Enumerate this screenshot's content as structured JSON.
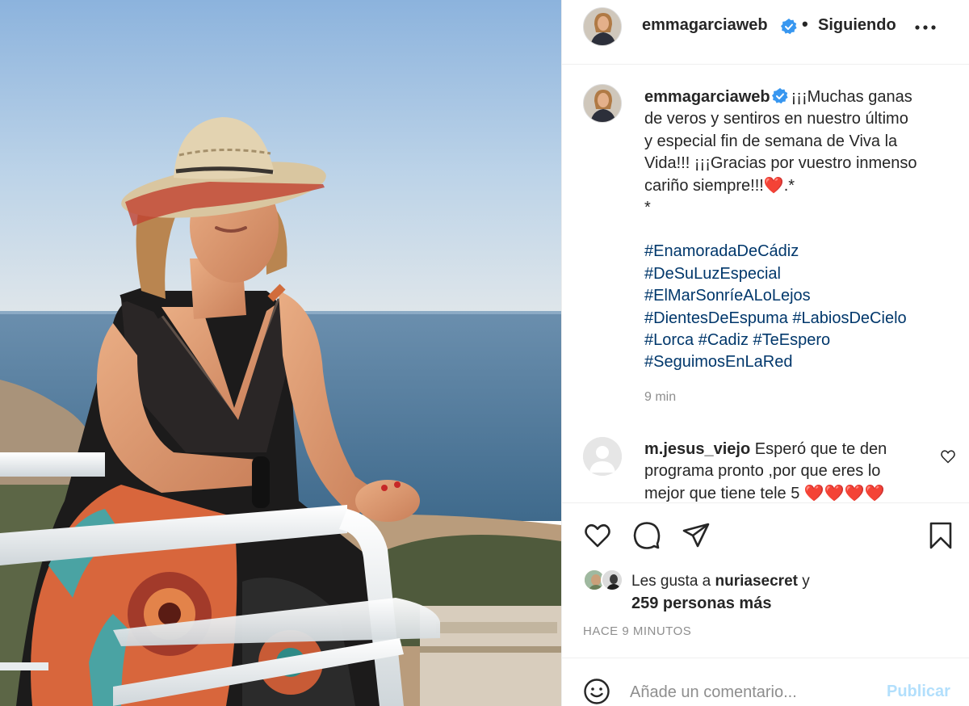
{
  "post": {
    "username": "emmagarciaweb",
    "follow_label": "Siguiendo",
    "separator": "•",
    "caption_lines": [
      "¡¡¡Muchas ganas",
      "de veros y sentiros en nuestro último",
      "y especial fin de semana de Viva la",
      "Vida!!! ¡¡¡Gracias por vuestro inmenso",
      "cariño siempre!!!❤️.*",
      "*"
    ],
    "hashtag_lines": [
      "#EnamoradaDeCádiz",
      "#DeSuLuzEspecial",
      "#ElMarSonríeALoLejos",
      "#DientesDeEspuma #LabiosDeCielo",
      "#Lorca #Cadiz #TeEspero",
      "#SeguimosEnLaRed"
    ],
    "caption_time": "9 min"
  },
  "comment": {
    "username": "m.jesus_viejo",
    "text": "Esperó que te den programa pronto ,por que eres lo mejor que tiene tele 5 ❤️❤️❤️❤️"
  },
  "likes": {
    "prefix": "Les gusta a",
    "user": "nuriasecret",
    "suffix": "y",
    "others": "259 personas más"
  },
  "timestamp": "HACE 9 MINUTOS",
  "composer": {
    "placeholder": "Añade un comentario...",
    "publish_label": "Publicar"
  },
  "icons": {
    "more": "more-dots-icon",
    "verified": "verified-badge-icon",
    "like": "heart-icon",
    "comment": "comment-bubble-icon",
    "share": "paper-plane-icon",
    "save": "bookmark-icon",
    "emoji": "emoji-smile-icon"
  },
  "colors": {
    "verified_blue": "#3897f0",
    "hashtag": "#00376b",
    "muted": "#8e8e8e",
    "publish_disabled": "#b2dffc"
  }
}
